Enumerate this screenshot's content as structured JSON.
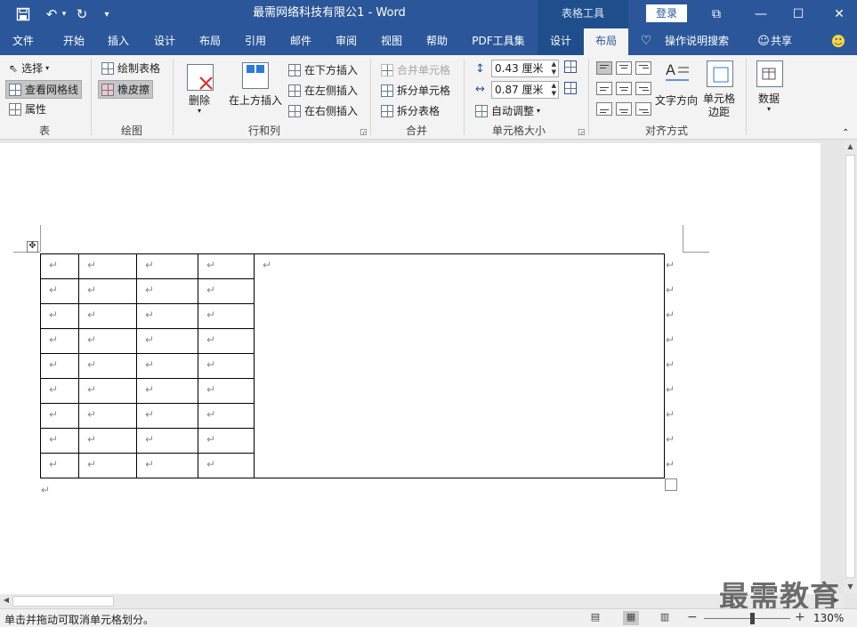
{
  "title_bar": {
    "doc_title": "最需网络科技有限公1  -  Word",
    "context_label": "表格工具",
    "login_label": "登录",
    "icons": [
      "save-icon",
      "undo-icon",
      "redo-icon",
      "customize-quick-access-icon",
      "ribbon-display-options-icon",
      "minimize-icon",
      "maximize-icon",
      "close-icon"
    ]
  },
  "tabs": [
    "文件",
    "开始",
    "插入",
    "设计",
    "布局",
    "引用",
    "邮件",
    "审阅",
    "视图",
    "帮助",
    "PDF工具集",
    "设计",
    "布局"
  ],
  "tell_me": "操作说明搜索",
  "share": "共享",
  "ribbon": {
    "table_group": {
      "label": "表",
      "select": "选择",
      "view_gridlines": "查看网格线",
      "properties": "属性"
    },
    "draw_group": {
      "label": "绘图",
      "draw_table": "绘制表格",
      "eraser": "橡皮擦"
    },
    "rows_cols_group": {
      "label": "行和列",
      "delete": "删除",
      "insert_above": "在上方插入",
      "insert_below": "在下方插入",
      "insert_left": "在左侧插入",
      "insert_right": "在右侧插入"
    },
    "merge_group": {
      "label": "合并",
      "merge_cells": "合并单元格",
      "split_cells": "拆分单元格",
      "split_table": "拆分表格"
    },
    "cell_size_group": {
      "label": "单元格大小",
      "height": "0.43 厘米",
      "width": "0.87 厘米",
      "autofit": "自动调整"
    },
    "alignment_group": {
      "label": "对齐方式",
      "text_direction": "文字方向",
      "cell_margins": "单元格\n边距"
    },
    "data_group": {
      "label": "数据"
    }
  },
  "document": {
    "end_mark": "↵",
    "table": {
      "rows": 9,
      "left_columns": 4
    }
  },
  "status": {
    "text": "单击并拖动可取消单元格划分。",
    "zoom_minus": "−",
    "zoom_plus": "+",
    "zoom": "130%",
    "zoom_fraction": 0.56
  },
  "watermark": "最需教育"
}
